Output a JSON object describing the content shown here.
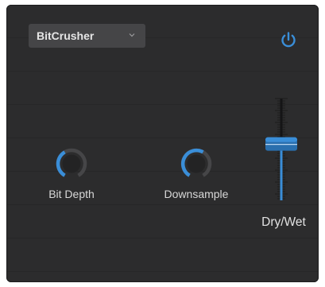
{
  "preset": {
    "name": "BitCrusher",
    "chevron_icon": "chevron-down-icon"
  },
  "power": {
    "icon": "power-icon",
    "state": "on"
  },
  "knobs": [
    {
      "label": "Bit Depth",
      "value": 0.4
    },
    {
      "label": "Downsample",
      "value": 0.6
    }
  ],
  "dry_wet": {
    "label": "Dry/Wet",
    "value": 0.55
  },
  "colors": {
    "accent": "#3a8ed8",
    "panel": "#2c2c2d",
    "dropdown": "#454547",
    "text": "#d8d8d8"
  }
}
